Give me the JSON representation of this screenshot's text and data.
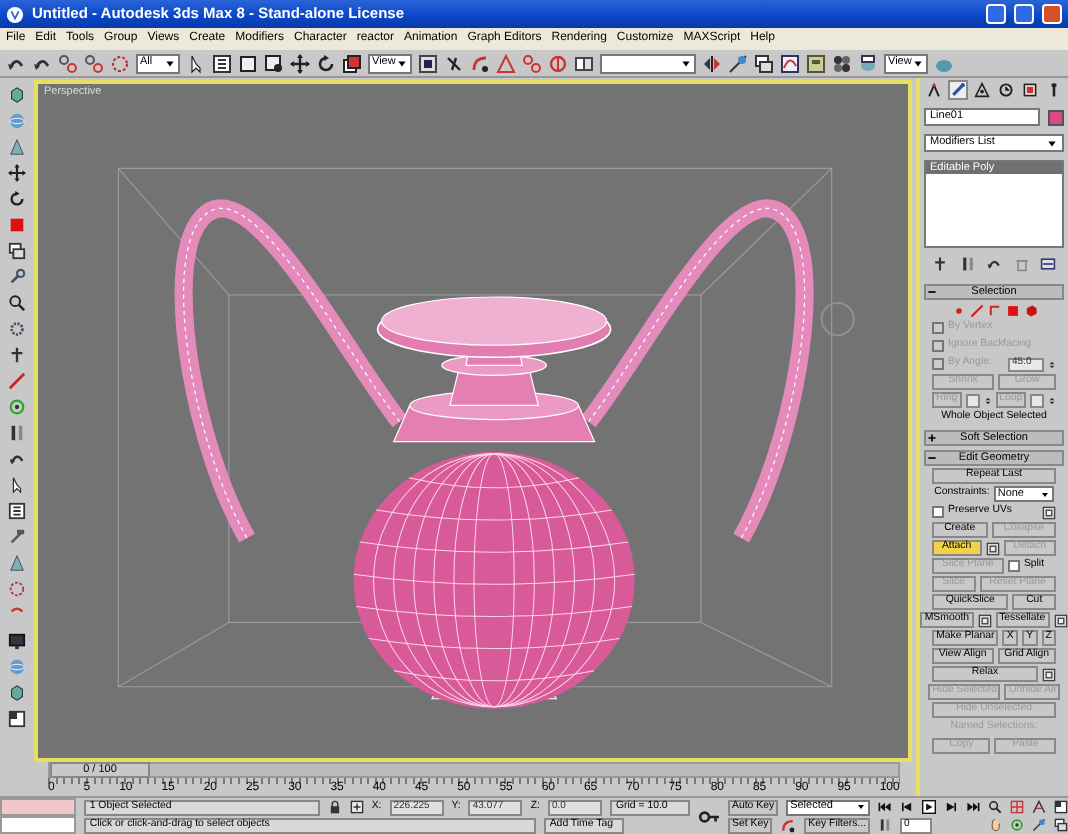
{
  "window": {
    "title": "Untitled - Autodesk 3ds Max 8 - Stand-alone License"
  },
  "menu": [
    "File",
    "Edit",
    "Tools",
    "Group",
    "Views",
    "Create",
    "Modifiers",
    "Character",
    "reactor",
    "Animation",
    "Graph Editors",
    "Rendering",
    "Customize",
    "MAXScript",
    "Help"
  ],
  "toolbar": [
    {
      "kind": "tool"
    },
    {
      "kind": "tool"
    },
    {
      "kind": "tool"
    },
    {
      "kind": "tool"
    },
    {
      "kind": "tool"
    },
    {
      "kind": "dropdown",
      "value": "All"
    },
    {
      "kind": "tool"
    },
    {
      "kind": "tool"
    },
    {
      "kind": "tool"
    },
    {
      "kind": "tool"
    },
    {
      "kind": "tool"
    },
    {
      "kind": "tool"
    },
    {
      "kind": "tool"
    },
    {
      "kind": "dropdown",
      "value": "View"
    },
    {
      "kind": "tool"
    },
    {
      "kind": "tool"
    },
    {
      "kind": "tool"
    },
    {
      "kind": "tool"
    },
    {
      "kind": "tool"
    },
    {
      "kind": "tool"
    },
    {
      "kind": "tool"
    },
    {
      "kind": "dropdown"
    },
    {
      "kind": "tool"
    },
    {
      "kind": "tool"
    },
    {
      "kind": "tool"
    },
    {
      "kind": "tool"
    },
    {
      "kind": "tool"
    },
    {
      "kind": "tool"
    },
    {
      "kind": "tool"
    },
    {
      "kind": "dropdown",
      "value": "View"
    },
    {
      "kind": "tool"
    }
  ],
  "viewport": {
    "label": "Perspective"
  },
  "command_panel": {
    "tabs": [
      {
        "selected": false
      },
      {
        "selected": true
      },
      {
        "selected": false
      },
      {
        "selected": false
      },
      {
        "selected": false
      },
      {
        "selected": false
      }
    ],
    "object_name": "Line01",
    "modifier_list": "Modifiers List",
    "stack": [
      {
        "label": "Editable Poly",
        "selected": true
      }
    ],
    "rollouts": [
      {
        "title": "Selection",
        "expanded": true,
        "rows": [
          [
            {
              "kind": "subobjects"
            }
          ],
          [
            {
              "kind": "checkbox",
              "label": "By Vertex",
              "checked": false,
              "disabled": true
            }
          ],
          [
            {
              "kind": "checkbox",
              "label": "Ignore Backfacing",
              "checked": false,
              "disabled": true
            }
          ],
          [
            {
              "kind": "checkbox",
              "label": "By Angle:",
              "checked": false,
              "disabled": true
            },
            {
              "kind": "spinner",
              "value": "45.0",
              "disabled": true
            }
          ],
          [
            {
              "kind": "button",
              "label": "Shrink",
              "disabled": true,
              "active": false
            },
            {
              "kind": "button",
              "label": "Grow",
              "disabled": true,
              "active": false
            }
          ],
          [
            {
              "kind": "button",
              "label": "Ring",
              "disabled": true,
              "active": false
            },
            {
              "kind": "spinner",
              "disabled": true
            },
            {
              "kind": "button",
              "label": "Loop",
              "disabled": true,
              "active": false
            },
            {
              "kind": "spinner",
              "disabled": true
            }
          ],
          [
            {
              "kind": "label",
              "text": "Whole Object Selected",
              "disabled": false
            }
          ]
        ]
      },
      {
        "title": "Soft Selection",
        "expanded": false
      },
      {
        "title": "Edit Geometry",
        "expanded": true,
        "rows": [
          [
            {
              "kind": "button",
              "label": "Repeat Last",
              "disabled": false,
              "active": false
            }
          ],
          [
            {
              "kind": "label",
              "text": "Constraints:",
              "disabled": false
            },
            {
              "kind": "select",
              "value": "None"
            }
          ],
          [
            {
              "kind": "checkbox",
              "label": "Preserve UVs",
              "checked": false,
              "disabled": false
            },
            {
              "kind": "settings"
            }
          ],
          [
            {
              "kind": "button",
              "label": "Create",
              "disabled": false,
              "active": false
            },
            {
              "kind": "button",
              "label": "Collapse",
              "disabled": true,
              "active": false
            }
          ],
          [
            {
              "kind": "button",
              "label": "Attach",
              "disabled": false,
              "active": true
            },
            {
              "kind": "settings"
            },
            {
              "kind": "button",
              "label": "Detach",
              "disabled": true,
              "active": false
            }
          ],
          [
            {
              "kind": "button",
              "label": "Slice Plane",
              "disabled": true,
              "active": false
            },
            {
              "kind": "checkbox",
              "label": "Split",
              "checked": false,
              "disabled": false
            }
          ],
          [
            {
              "kind": "button",
              "label": "Slice",
              "disabled": true,
              "active": false
            },
            {
              "kind": "button",
              "label": "Reset Plane",
              "disabled": true,
              "active": false
            }
          ],
          [
            {
              "kind": "button",
              "label": "QuickSlice",
              "disabled": false,
              "active": false
            },
            {
              "kind": "button",
              "label": "Cut",
              "disabled": false,
              "active": false
            }
          ],
          [
            {
              "kind": "button",
              "label": "MSmooth",
              "disabled": false,
              "active": false
            },
            {
              "kind": "settings"
            },
            {
              "kind": "button",
              "label": "Tessellate",
              "disabled": false,
              "active": false
            },
            {
              "kind": "settings"
            }
          ],
          [
            {
              "kind": "button",
              "label": "Make Planar",
              "disabled": false,
              "active": false
            },
            {
              "kind": "button",
              "label": "X",
              "disabled": false,
              "active": false
            },
            {
              "kind": "button",
              "label": "Y",
              "disabled": false,
              "active": false
            },
            {
              "kind": "button",
              "label": "Z",
              "disabled": false,
              "active": false
            }
          ],
          [
            {
              "kind": "button",
              "label": "View Align",
              "disabled": false,
              "active": false
            },
            {
              "kind": "button",
              "label": "Grid Align",
              "disabled": false,
              "active": false
            }
          ],
          [
            {
              "kind": "button",
              "label": "Relax",
              "disabled": false,
              "active": false
            },
            {
              "kind": "settings"
            }
          ],
          [
            {
              "kind": "button",
              "label": "Hide Selected",
              "disabled": true,
              "active": false
            },
            {
              "kind": "button",
              "label": "Unhide All",
              "disabled": true,
              "active": false
            }
          ],
          [
            {
              "kind": "button",
              "label": "Hide Unselected",
              "disabled": true,
              "active": false
            }
          ],
          [
            {
              "kind": "label",
              "text": "Named Selections:",
              "disabled": true
            }
          ],
          [
            {
              "kind": "button",
              "label": "Copy",
              "disabled": true,
              "active": false
            },
            {
              "kind": "button",
              "label": "Paste",
              "disabled": true,
              "active": false
            }
          ]
        ]
      }
    ]
  },
  "time_slider": {
    "label": "0 / 100"
  },
  "track_bar": {
    "labels": [
      "0",
      "5",
      "10",
      "15",
      "20",
      "25",
      "30",
      "35",
      "40",
      "45",
      "50",
      "55",
      "60",
      "65",
      "70",
      "75",
      "80",
      "85",
      "90",
      "95",
      "100"
    ]
  },
  "status_bar": {
    "selection": "1 Object Selected",
    "prompt": "Click or click-and-drag to select objects",
    "coords": [
      {
        "axis": "X:",
        "value": "226.225"
      },
      {
        "axis": "Y:",
        "value": "43.077"
      },
      {
        "axis": "Z:",
        "value": "0.0"
      }
    ],
    "grid": "Grid = 10.0",
    "time_tag": "Add Time Tag",
    "auto_key": {
      "label": "Auto Key",
      "active": false
    },
    "key_mode": "Selected",
    "set_key": "Set Key",
    "key_filters": "Key Filters...",
    "frame": "0"
  }
}
